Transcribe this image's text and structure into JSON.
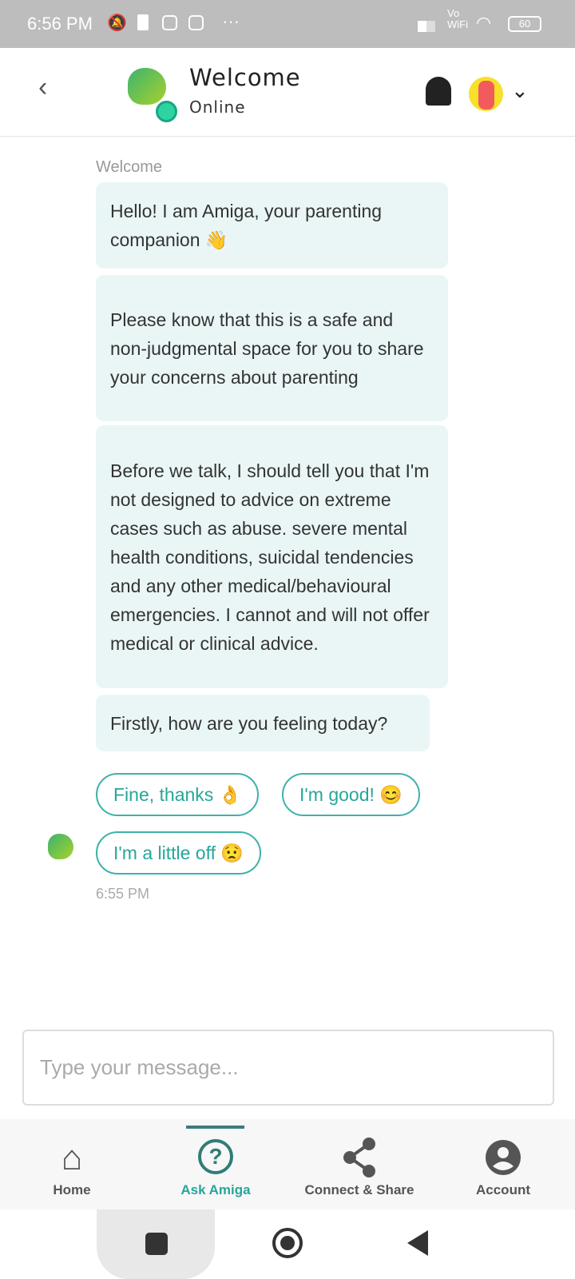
{
  "status_bar": {
    "time": "6:56 PM",
    "battery": "60",
    "network": "Vo WiFi"
  },
  "header": {
    "title": "Welcome",
    "subtitle": "Online"
  },
  "chat": {
    "section_label": "Welcome",
    "messages": [
      "Hello! I am Amiga, your parenting companion 👋",
      "Please know that this is a safe and non-judgmental space for you to share your concerns about parenting",
      "Before we talk, I should tell you that I'm not designed to advice on extreme cases such as abuse. severe mental health conditions, suicidal tendencies and any other medical/behavioural emergencies. I cannot and will not offer medical or clinical advice.",
      "Firstly, how are you feeling today?"
    ],
    "quick_replies": [
      "Fine, thanks 👌",
      "I'm good! 😊",
      "I'm a little off 😟"
    ],
    "timestamp": "6:55 PM"
  },
  "composer": {
    "placeholder": "Type your message..."
  },
  "bottom_nav": {
    "active": "Ask Amiga",
    "accent": "#26a69a",
    "items": [
      {
        "label": "Home",
        "icon": "home-icon"
      },
      {
        "label": "Ask Amiga",
        "icon": "question-bubble-icon"
      },
      {
        "label": "Connect & Share",
        "icon": "share-icon"
      },
      {
        "label": "Account",
        "icon": "account-icon"
      }
    ]
  }
}
